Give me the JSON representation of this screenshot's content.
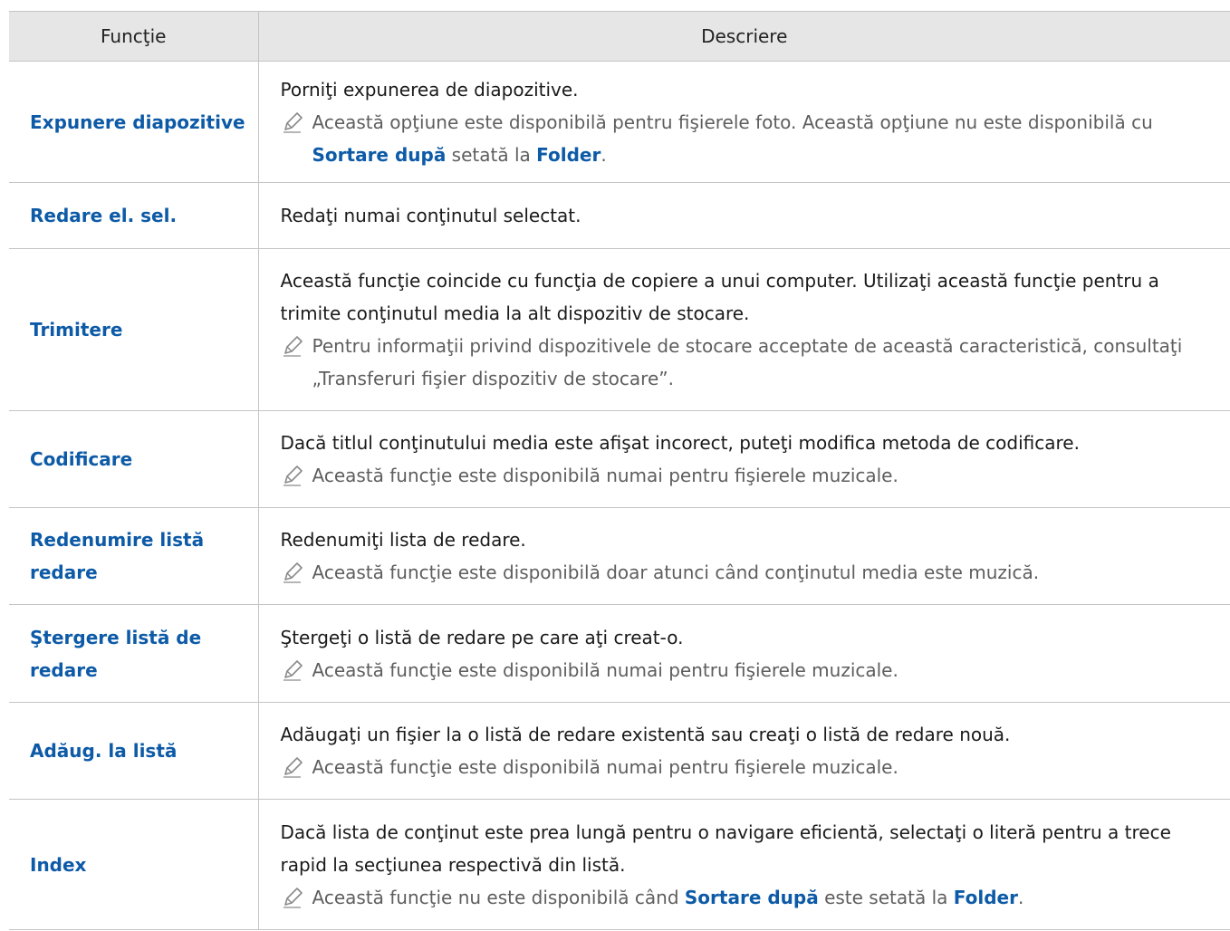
{
  "table": {
    "headers": {
      "function": "Funcţie",
      "description": "Descriere"
    },
    "rows": [
      {
        "name": "Expunere diapozitive",
        "desc": "Porniţi expunerea de diapozitive.",
        "note": {
          "pre": "Această opţiune este disponibilă pentru fişierele foto. Această opţiune nu este disponibilă cu ",
          "kw1": "Sortare după",
          "mid": " setată la ",
          "kw2": "Folder",
          "post": "."
        }
      },
      {
        "name": "Redare el. sel.",
        "desc": "Redaţi numai conţinutul selectat."
      },
      {
        "name": "Trimitere",
        "desc": "Această funcţie coincide cu funcţia de copiere a unui computer. Utilizaţi această funcţie pentru a trimite conţinutul media la alt dispozitiv de stocare.",
        "note": {
          "text": "Pentru informaţii privind dispozitivele de stocare acceptate de această caracteristică, consultaţi „Transferuri fişier dispozitiv de stocare”."
        }
      },
      {
        "name": "Codificare",
        "desc": "Dacă titlul conţinutului media este afişat incorect, puteţi modifica metoda de codificare.",
        "note": {
          "text": "Această funcţie este disponibilă numai pentru fişierele muzicale."
        }
      },
      {
        "name": "Redenumire listă redare",
        "desc": "Redenumiţi lista de redare.",
        "note": {
          "text": "Această funcţie este disponibilă doar atunci când conţinutul media este muzică."
        }
      },
      {
        "name": "Ştergere listă de redare",
        "desc": "Ştergeţi o listă de redare pe care aţi creat-o.",
        "note": {
          "text": "Această funcţie este disponibilă numai pentru fişierele muzicale."
        }
      },
      {
        "name": "Adăug. la listă",
        "desc": "Adăugaţi un fişier la o listă de redare existentă sau creaţi o listă de redare nouă.",
        "note": {
          "text": "Această funcţie este disponibilă numai pentru fişierele muzicale."
        }
      },
      {
        "name": "Index",
        "desc": "Dacă lista de conţinut este prea lungă pentru o navigare eficientă, selectaţi o literă pentru a trece rapid la secţiunea respectivă din listă.",
        "note": {
          "pre": "Această funcţie nu este disponibilă când ",
          "kw1": "Sortare după",
          "mid": " este setată la ",
          "kw2": "Folder",
          "post": "."
        }
      }
    ]
  },
  "colors": {
    "keyword": "#0d5aa7",
    "header_bg": "#e6e6e6",
    "note_text": "#5e5e5e",
    "border": "#c4c4c4"
  },
  "icons": {
    "note": "pencil-icon"
  }
}
